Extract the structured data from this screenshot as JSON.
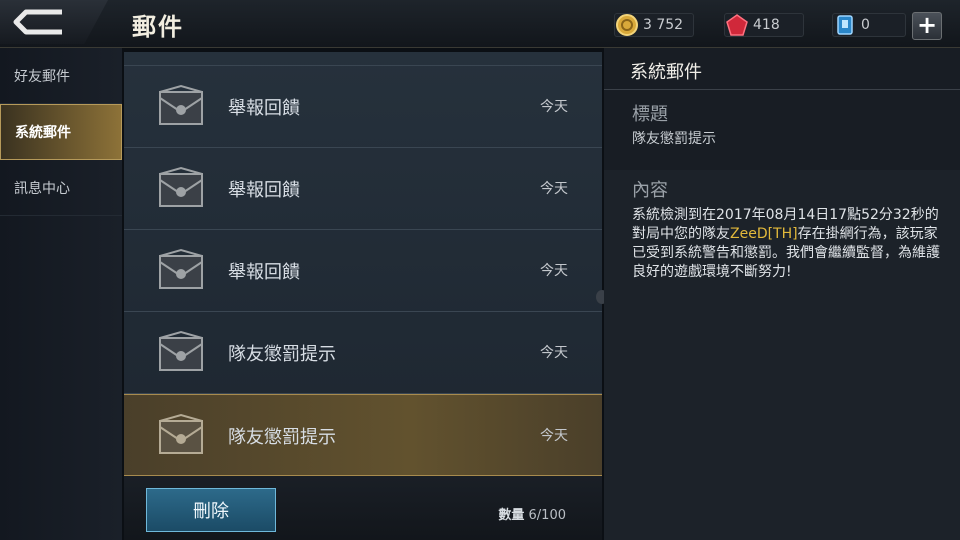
{
  "header": {
    "title": "郵件",
    "currencies": [
      {
        "icon": "gold-coin-icon",
        "value": "3 752"
      },
      {
        "icon": "ruby-gem-icon",
        "value": "418"
      },
      {
        "icon": "voucher-icon",
        "value": "0"
      }
    ],
    "add_label": "+"
  },
  "sidebar": {
    "items": [
      {
        "label": "好友郵件",
        "active": false
      },
      {
        "label": "系統郵件",
        "active": true
      },
      {
        "label": "訊息中心",
        "active": false
      }
    ]
  },
  "mail_list": {
    "items": [
      {
        "title": "舉報回饋",
        "date": "今天"
      },
      {
        "title": "舉報回饋",
        "date": "今天"
      },
      {
        "title": "舉報回饋",
        "date": "今天"
      },
      {
        "title": "隊友懲罰提示",
        "date": "今天"
      },
      {
        "title": "隊友懲罰提示",
        "date": "今天",
        "selected": true
      }
    ],
    "delete_label": "刪除",
    "count_label": "數量",
    "count_value": "6/100"
  },
  "detail": {
    "header": "系統郵件",
    "subject_label": "標題",
    "subject_value": "隊友懲罰提示",
    "content_label": "內容",
    "content_part1": "系統檢測到在2017年08月14日17點52分32秒的對局中您的隊友",
    "content_highlight": "ZeeD[TH]",
    "content_part2": "存在掛網行為，該玩家已受到系統警告和懲罰。我們會繼續監督，為維護良好的遊戲環境不斷努力!"
  }
}
